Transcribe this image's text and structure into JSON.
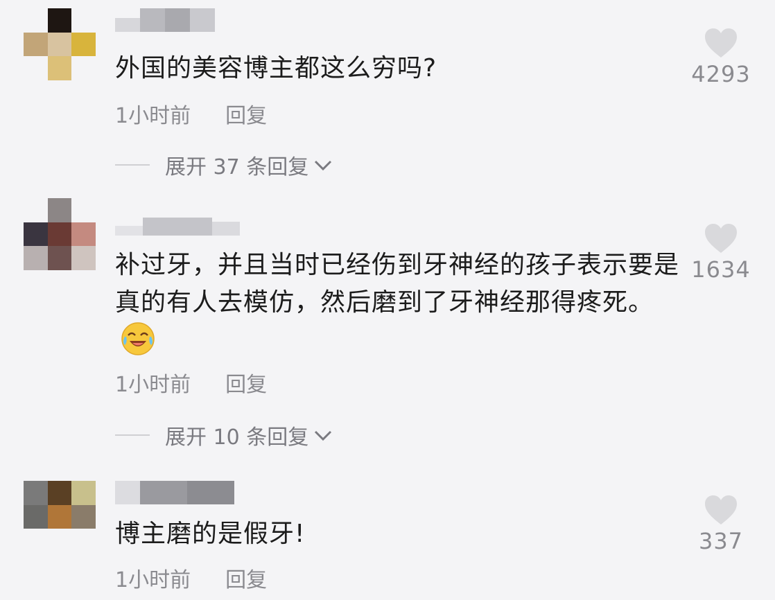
{
  "comments": [
    {
      "text": "外国的美容博主都这么穷吗?",
      "time": "1小时前",
      "reply_label": "回复",
      "likes": "4293",
      "expand_label": "展开 37 条回复"
    },
    {
      "text": "补过牙，并且当时已经伤到牙神经的孩子表示要是真的有人去模仿，然后磨到了牙神经那得疼死。",
      "emoji_icon": "crying-laughing-emoji",
      "time": "1小时前",
      "reply_label": "回复",
      "likes": "1634",
      "expand_label": "展开 10 条回复"
    },
    {
      "text": "博主磨的是假牙!",
      "time": "1小时前",
      "reply_label": "回复",
      "likes": "337"
    }
  ],
  "colors": {
    "background": "#f4f4f6",
    "text": "#1c1c1c",
    "secondary": "#8a8a8f",
    "heart": "#d9d9dc"
  },
  "icons": [
    "heart-icon",
    "chevron-down-icon",
    "crying-laughing-emoji"
  ]
}
